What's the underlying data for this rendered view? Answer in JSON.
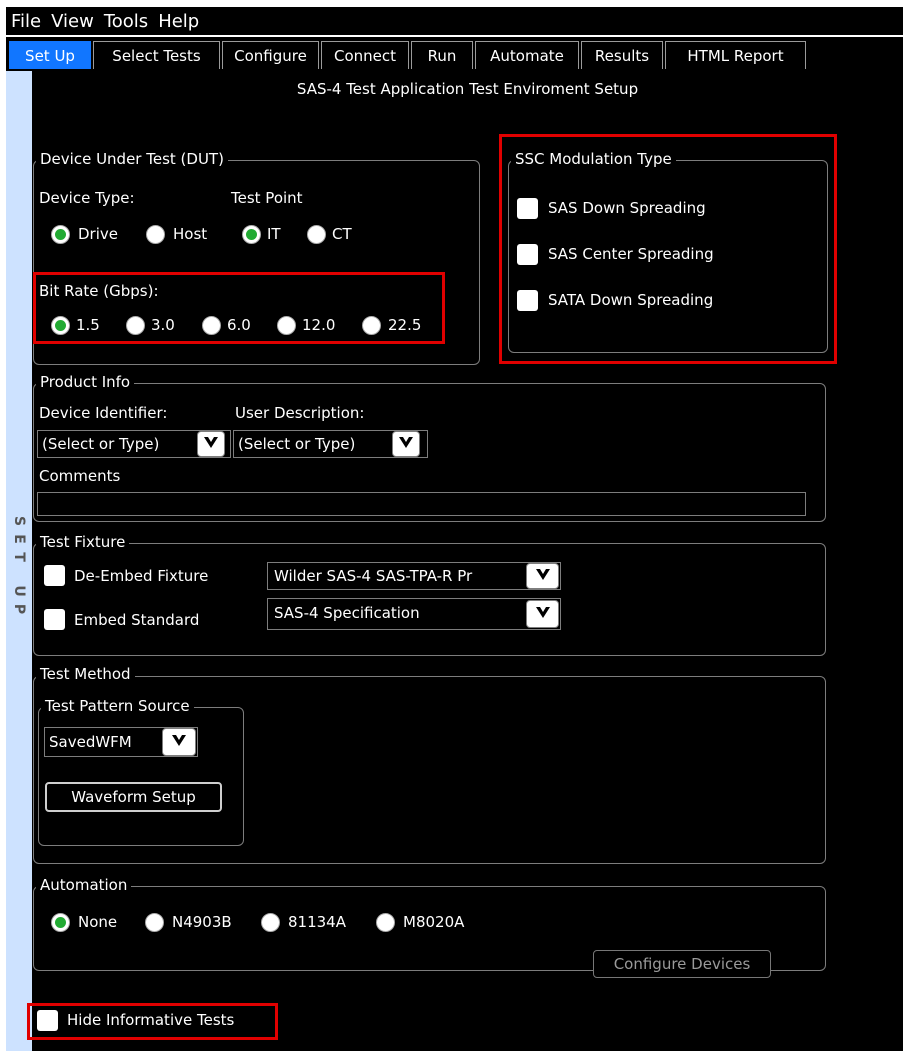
{
  "menu": [
    "File",
    "View",
    "Tools",
    "Help"
  ],
  "tabs": [
    "Set Up",
    "Select Tests",
    "Configure",
    "Connect",
    "Run",
    "Automate",
    "Results",
    "HTML Report"
  ],
  "rail": [
    "S",
    "E",
    "T",
    "U",
    "P"
  ],
  "page_title": "SAS-4 Test Application Test Enviroment Setup",
  "dut": {
    "legend": "Device Under Test (DUT)",
    "device_type_label": "Device Type:",
    "test_point_label": "Test Point",
    "device_types": [
      "Drive",
      "Host"
    ],
    "test_points": [
      "IT",
      "CT"
    ],
    "bit_rate_label": "Bit Rate (Gbps):",
    "bit_rates": [
      "1.5",
      "3.0",
      "6.0",
      "12.0",
      "22.5"
    ]
  },
  "ssc": {
    "legend": "SSC Modulation Type",
    "options": [
      "SAS Down Spreading",
      "SAS Center Spreading",
      "SATA Down Spreading"
    ]
  },
  "product": {
    "legend": "Product Info",
    "device_identifier_label": "Device Identifier:",
    "user_description_label": "User Description:",
    "device_identifier_value": "(Select or Type)",
    "user_description_value": "(Select or Type)",
    "comments_label": "Comments"
  },
  "fixture": {
    "legend": "Test Fixture",
    "deembed_label": "De-Embed Fixture",
    "embed_label": "Embed Standard",
    "deembed_value": "Wilder SAS-4 SAS-TPA-R Pr",
    "embed_value": "SAS-4 Specification"
  },
  "method": {
    "legend": "Test Method",
    "source_legend": "Test Pattern Source",
    "source_value": "SavedWFM",
    "waveform_button": "Waveform Setup"
  },
  "automation": {
    "legend": "Automation",
    "options": [
      "None",
      "N4903B",
      "81134A",
      "M8020A"
    ],
    "configure_button": "Configure Devices"
  },
  "hide_informative_label": "Hide Informative Tests"
}
